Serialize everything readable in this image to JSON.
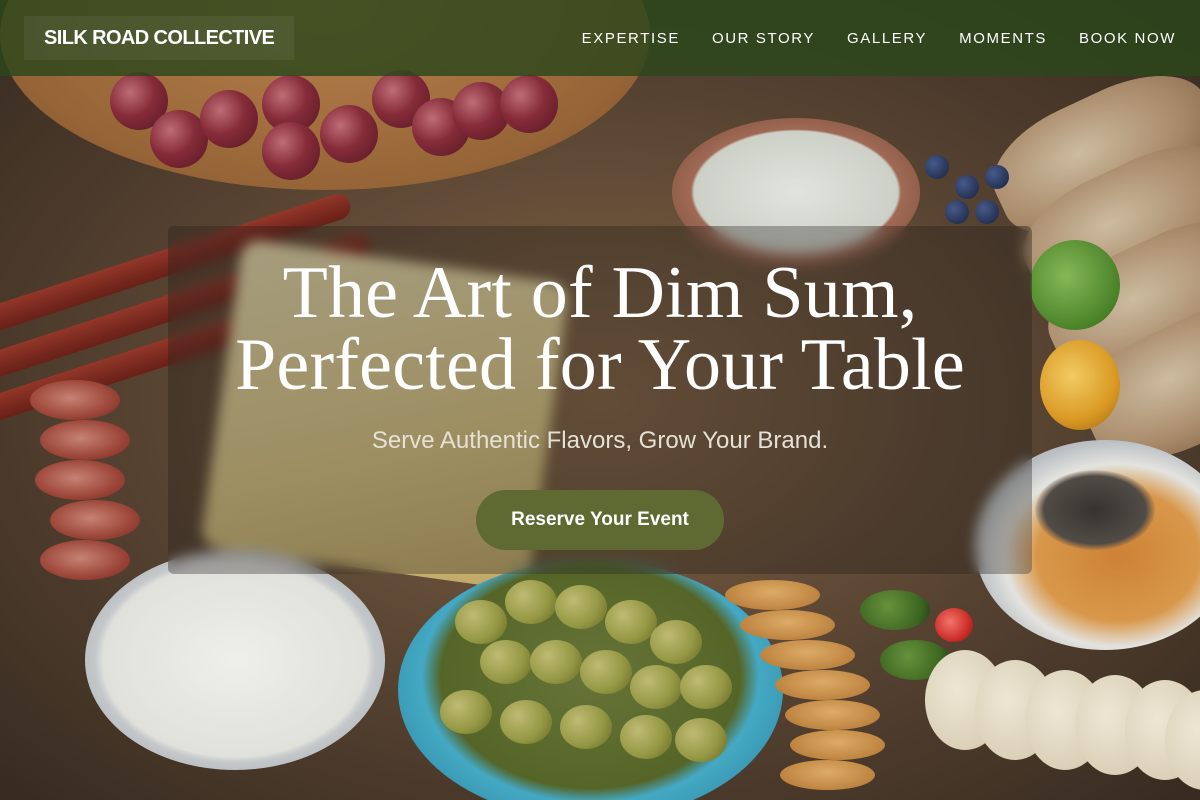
{
  "header": {
    "brand": "SILK ROAD COLLECTIVE",
    "nav": [
      {
        "label": "EXPERTISE"
      },
      {
        "label": "OUR STORY"
      },
      {
        "label": "GALLERY"
      },
      {
        "label": "MOMENTS"
      },
      {
        "label": "BOOK NOW"
      }
    ]
  },
  "hero": {
    "title_line1": "The Art of Dim Sum,",
    "title_line2": "Perfected for Your Table",
    "subtitle": "Serve Authentic Flavors, Grow Your Brand.",
    "cta_label": "Reserve Your Event"
  },
  "colors": {
    "nav_bg": "#2b471b",
    "cta_bg": "#5e6a32",
    "text_light": "#ffffff"
  }
}
